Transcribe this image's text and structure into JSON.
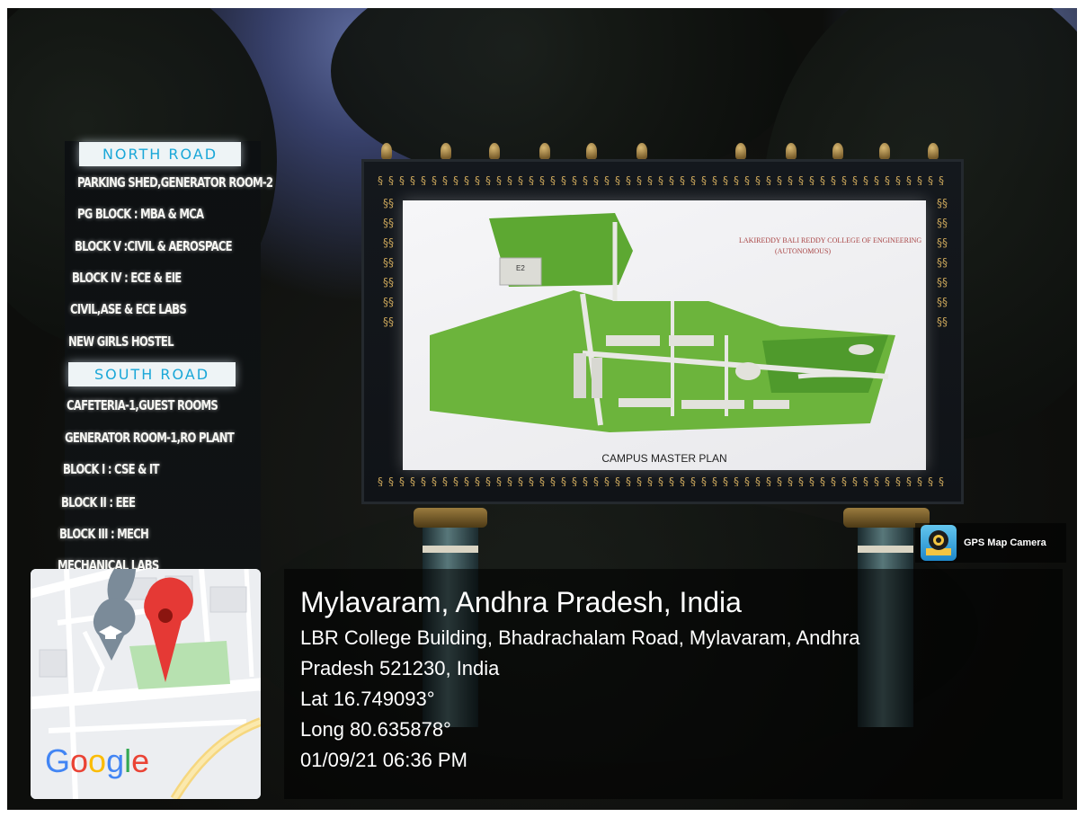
{
  "directory_sign": {
    "north_header": "NORTH ROAD",
    "north_items": [
      "PARKING SHED,GENERATOR ROOM-2",
      "PG BLOCK : MBA & MCA",
      "BLOCK V :CIVIL & AEROSPACE",
      "BLOCK IV : ECE & EIE",
      "CIVIL,ASE & ECE LABS",
      "NEW GIRLS HOSTEL"
    ],
    "south_header": "SOUTH ROAD",
    "south_items": [
      "CAFETERIA-1,GUEST ROOMS",
      "GENERATOR ROOM-1,RO PLANT",
      "BLOCK I : CSE & IT",
      "BLOCK II : EEE",
      "BLOCK III : MECH",
      "MECHANICAL LABS"
    ]
  },
  "billboard": {
    "caption": "CAMPUS MASTER PLAN",
    "college_name": "LAKIREDDY BALI REDDY COLLEGE OF ENGINEERING",
    "college_sub": "(AUTONOMOUS)",
    "building_label": "E2"
  },
  "gps_overlay": {
    "brand": "GPS Map Camera",
    "map_logo": "Google",
    "location_title": "Mylavaram, Andhra Pradesh, India",
    "address_line1": "LBR College Building, Bhadrachalam Road, Mylavaram, Andhra",
    "address_line2": "Pradesh 521230, India",
    "latitude": "Lat 16.749093°",
    "longitude": "Long 80.635878°",
    "timestamp": "01/09/21 06:36 PM",
    "icons": [
      "camera-pin-icon",
      "map-pin-icon",
      "graduation-cap-icon"
    ]
  },
  "colors": {
    "sign_header": "#1aa7d8",
    "pin_red": "#e53935",
    "map_green": "#b7e1b0",
    "billboard_green": "#5da832"
  }
}
